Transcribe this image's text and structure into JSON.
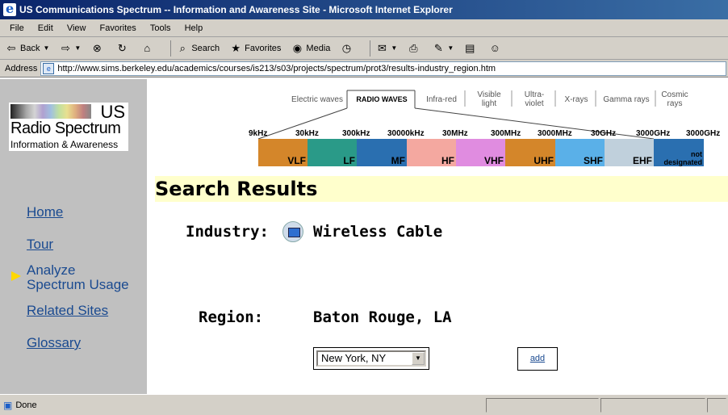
{
  "window": {
    "title": "US Communications Spectrum -- Information and Awareness Site - Microsoft Internet Explorer"
  },
  "menu": [
    "File",
    "Edit",
    "View",
    "Favorites",
    "Tools",
    "Help"
  ],
  "toolbar": {
    "back": "Back",
    "search": "Search",
    "favorites": "Favorites",
    "media": "Media"
  },
  "address": {
    "label": "Address",
    "url": "http://www.sims.berkeley.edu/academics/courses/is213/s03/projects/spectrum/prot3/results-industry_region.htm"
  },
  "logo": {
    "us": "US",
    "line1": "Radio Spectrum",
    "line2": "Information & Awareness"
  },
  "nav": {
    "home": "Home",
    "tour": "Tour",
    "analyze1": "Analyze",
    "analyze2": "Spectrum Usage",
    "related": "Related Sites",
    "glossary": "Glossary"
  },
  "spectrum": {
    "bands_top": [
      "Electric waves",
      "RADIO WAVES",
      "Infra-red",
      "Visible light",
      "Ultra-violet",
      "X-rays",
      "Gamma rays",
      "Cosmic rays"
    ],
    "freqs": [
      "9kHz",
      "30kHz",
      "300kHz",
      "30000kHz",
      "30MHz",
      "300MHz",
      "3000MHz",
      "30GHz",
      "3000GHz",
      "3000GHz"
    ],
    "bars": [
      {
        "label": "VLF",
        "color": "#d4862a"
      },
      {
        "label": "LF",
        "color": "#2a9a88"
      },
      {
        "label": "MF",
        "color": "#2a6fb0"
      },
      {
        "label": "HF",
        "color": "#f4a8a0"
      },
      {
        "label": "VHF",
        "color": "#e08ce0"
      },
      {
        "label": "UHF",
        "color": "#d4862a"
      },
      {
        "label": "SHF",
        "color": "#5ab0e8"
      },
      {
        "label": "EHF",
        "color": "#c0d0dc"
      },
      {
        "label": "not designated",
        "color": "#2a6fb0"
      }
    ]
  },
  "results": {
    "title": "Search Results",
    "industry_label": "Industry:",
    "industry_value": "Wireless Cable",
    "region_label": "Region:",
    "region_value": "Baton Rouge, LA"
  },
  "region_select": {
    "value": "New York, NY"
  },
  "add_label": "add",
  "status": {
    "text": "Done"
  }
}
